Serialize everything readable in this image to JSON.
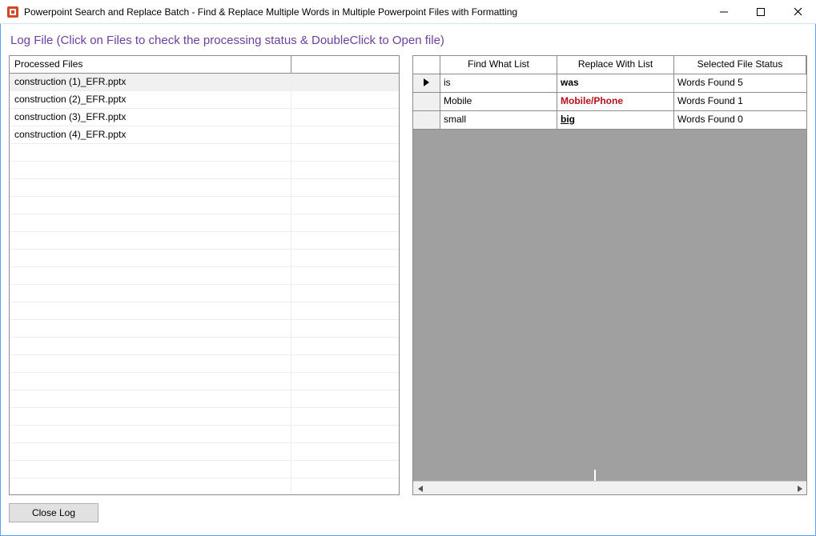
{
  "window": {
    "title": "Powerpoint Search and Replace Batch - Find & Replace Multiple Words in Multiple Powerpoint Files with Formatting"
  },
  "heading": "Log File (Click on Files to check the processing status & DoubleClick to Open file)",
  "left": {
    "header": "Processed Files",
    "rows": [
      "construction (1)_EFR.pptx",
      "construction (2)_EFR.pptx",
      "construction (3)_EFR.pptx",
      "construction (4)_EFR.pptx"
    ],
    "selected_index": 0,
    "empty_row_count": 20
  },
  "grid": {
    "headers": {
      "a": "Find What List",
      "b": "Replace With List",
      "c": "Selected File Status"
    },
    "rows": [
      {
        "marker": true,
        "find": "is",
        "replace": "was",
        "replace_fmt": "bold",
        "status": "Words Found 5"
      },
      {
        "marker": false,
        "find": "Mobile",
        "replace": "Mobile/Phone",
        "replace_fmt": "red",
        "status": "Words Found 1"
      },
      {
        "marker": false,
        "find": "small",
        "replace": "big",
        "replace_fmt": "underline-bold",
        "status": "Words Found 0"
      }
    ]
  },
  "buttons": {
    "close_log": "Close Log"
  }
}
